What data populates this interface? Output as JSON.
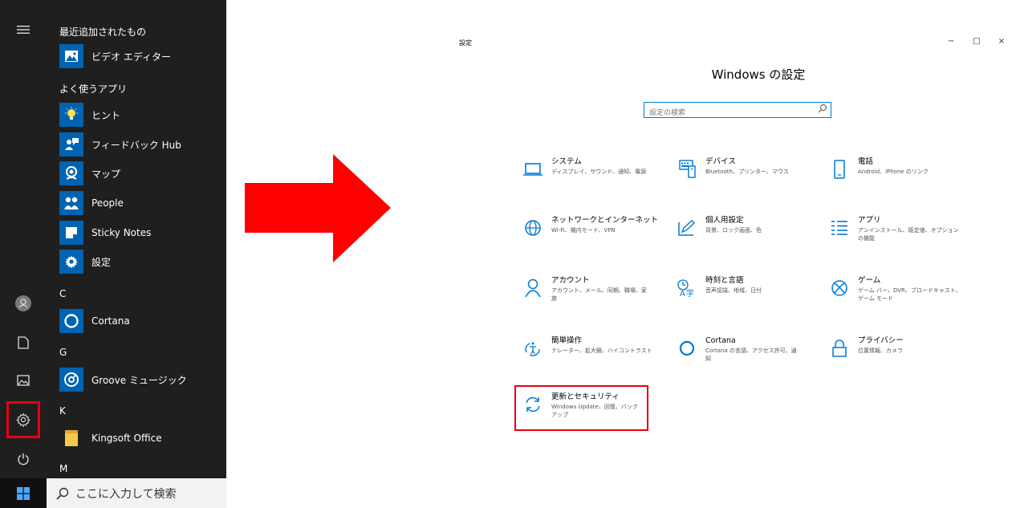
{
  "start_menu": {
    "recent_header": "最近追加されたもの",
    "recent_apps": [
      {
        "label": "ビデオ エディター",
        "icon": "video-editor-icon"
      }
    ],
    "frequent_header": "よく使うアプリ",
    "frequent_apps": [
      {
        "label": "ヒント",
        "icon": "lightbulb-icon"
      },
      {
        "label": "フィードバック Hub",
        "icon": "feedback-hub-icon"
      },
      {
        "label": "マップ",
        "icon": "map-pin-icon"
      },
      {
        "label": "People",
        "icon": "people-icon"
      },
      {
        "label": "Sticky Notes",
        "icon": "sticky-notes-icon"
      },
      {
        "label": "設定",
        "icon": "gear-icon"
      }
    ],
    "letter_c": "C",
    "cortana": "Cortana",
    "letter_g": "G",
    "groove": "Groove ミュージック",
    "letter_k": "K",
    "kingsoft": "Kingsoft Office",
    "letter_m": "M",
    "rail": [
      "menu-icon",
      "user-avatar-icon",
      "document-icon",
      "pictures-icon",
      "gear-icon",
      "power-icon"
    ]
  },
  "taskbar": {
    "search_placeholder": "ここに入力して検索"
  },
  "settings": {
    "window_title": "設定",
    "window_controls": {
      "minimize": "−",
      "maximize": "□",
      "close": "×"
    },
    "heading": "Windows の設定",
    "search_placeholder": "設定の検索",
    "categories": [
      {
        "title": "システム",
        "desc": "ディスプレイ、サウンド、通知、電源",
        "icon": "laptop-icon"
      },
      {
        "title": "デバイス",
        "desc": "Bluetooth、プリンター、マウス",
        "icon": "keyboard-icon"
      },
      {
        "title": "電話",
        "desc": "Android、iPhone のリンク",
        "icon": "phone-icon"
      },
      {
        "title": "ネットワークとインターネット",
        "desc": "Wi-Fi、機内モード、VPN",
        "icon": "globe-icon"
      },
      {
        "title": "個人用設定",
        "desc": "背景、ロック画面、色",
        "icon": "pen-tablet-icon"
      },
      {
        "title": "アプリ",
        "desc": "アンインストール、既定値、オプション",
        "desc2": "の機能",
        "icon": "apps-list-icon"
      },
      {
        "title": "アカウント",
        "desc": "アカウント、メール、同期、職場、家",
        "desc2": "族",
        "icon": "person-icon"
      },
      {
        "title": "時刻と言語",
        "desc": "音声認識、地域、日付",
        "icon": "time-language-icon"
      },
      {
        "title": "ゲーム",
        "desc": "ゲーム バー、DVR、ブロードキャスト、",
        "desc2": "ゲーム モード",
        "icon": "xbox-icon"
      },
      {
        "title": "簡単操作",
        "desc": "ナレーター、拡大鏡、ハイコントラスト",
        "icon": "ease-of-access-icon"
      },
      {
        "title": "Cortana",
        "desc": "Cortana の言語、アクセス許可、通",
        "desc2": "知",
        "icon": "cortana-ring-icon"
      },
      {
        "title": "プライバシー",
        "desc": "位置情報、カメラ",
        "icon": "lock-icon"
      },
      {
        "title": "更新とセキュリティ",
        "desc": "Windows Update、回復、バック",
        "desc2": "アップ",
        "icon": "sync-icon"
      }
    ]
  },
  "colors": {
    "accent": "#0078d4",
    "tile_blue": "#0063b1",
    "highlight_red": "#e60012",
    "arrow_red": "#ff0000",
    "start_bg": "#1f1f1f"
  }
}
